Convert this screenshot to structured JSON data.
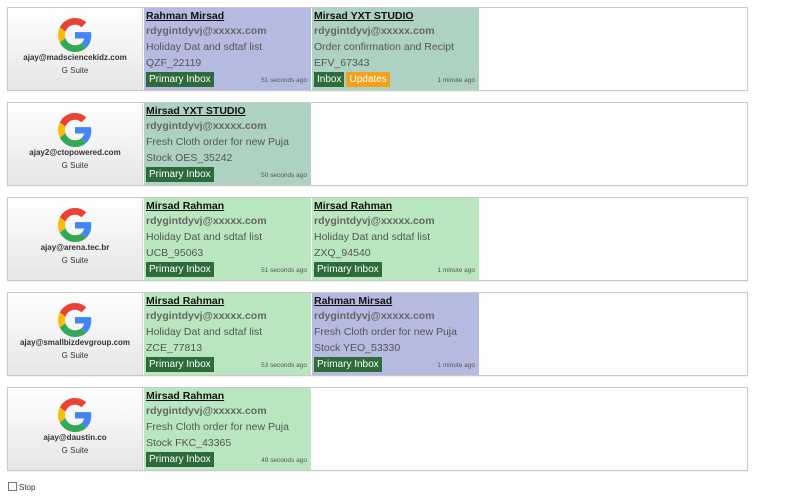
{
  "stop_label": "Stop",
  "colors": {
    "purple": "#b5bbe0",
    "green": "#b9e6be",
    "teal": "#aed2c1",
    "label_green": "#2e6b3b",
    "label_orange": "#f3a01a"
  },
  "rows": [
    {
      "account_icon": "google-g-icon",
      "email": "ajay@madsciencekidz.com",
      "suite": "G Suite",
      "cards": [
        {
          "color": "purple",
          "sender": "Rahman Mirsad",
          "address": "rdygintdyvj@xxxxx.com",
          "subject": "Holiday Dat and sdtaf list",
          "code": "QZF_22119",
          "labels": [
            {
              "text": "Primary Inbox",
              "style": "green"
            }
          ],
          "time": "51 seconds ago"
        },
        {
          "color": "teal",
          "sender": "Mirsad YXT STUDIO",
          "address": "rdygintdyvj@xxxxx.com",
          "subject": "Order confirmation and Recipt",
          "code": "EFV_67343",
          "labels": [
            {
              "text": "Inbox",
              "style": "green"
            },
            {
              "text": "Updates",
              "style": "orange"
            }
          ],
          "time": "1 minute ago"
        }
      ]
    },
    {
      "account_icon": "google-g-icon",
      "email": "ajay2@ctopowered.com",
      "suite": "G Suite",
      "cards": [
        {
          "color": "teal",
          "sender": "Mirsad YXT STUDIO",
          "address": "rdygintdyvj@xxxxx.com",
          "subject": "Fresh Cloth order for new Puja",
          "code": "Stock OES_35242",
          "labels": [
            {
              "text": "Primary Inbox",
              "style": "green"
            }
          ],
          "time": "50 seconds ago"
        }
      ]
    },
    {
      "account_icon": "google-g-icon",
      "email": "ajay@arena.tec.br",
      "suite": "G Suite",
      "cards": [
        {
          "color": "green",
          "sender": "Mirsad Rahman",
          "address": "rdygintdyvj@xxxxx.com",
          "subject": "Holiday Dat and sdtaf list",
          "code": "UCB_95063",
          "labels": [
            {
              "text": "Primary Inbox",
              "style": "green"
            }
          ],
          "time": "51 seconds ago"
        },
        {
          "color": "green",
          "sender": "Mirsad Rahman",
          "address": "rdygintdyvj@xxxxx.com",
          "subject": "Holiday Dat and sdtaf list",
          "code": "ZXQ_94540",
          "labels": [
            {
              "text": "Primary Inbox",
              "style": "green"
            }
          ],
          "time": "1 minute ago"
        }
      ]
    },
    {
      "account_icon": "google-g-icon",
      "email": "ajay@smallbizdevgroup.com",
      "suite": "G Suite",
      "cards": [
        {
          "color": "green",
          "sender": "Mirsad Rahman",
          "address": "rdygintdyvj@xxxxx.com",
          "subject": "Holiday Dat and sdtaf list",
          "code": "ZCE_77813",
          "labels": [
            {
              "text": "Primary Inbox",
              "style": "green"
            }
          ],
          "time": "53 seconds ago"
        },
        {
          "color": "purple",
          "sender": "Rahman Mirsad",
          "address": "rdygintdyvj@xxxxx.com",
          "subject": "Fresh Cloth order for new Puja",
          "code": "Stock YEO_53330",
          "labels": [
            {
              "text": "Primary Inbox",
              "style": "green"
            }
          ],
          "time": "1 minute ago"
        }
      ]
    },
    {
      "account_icon": "google-g-icon",
      "email": "ajay@daustin.co",
      "suite": "G Suite",
      "cards": [
        {
          "color": "green",
          "sender": "Mirsad Rahman",
          "address": "rdygintdyvj@xxxxx.com",
          "subject": "Fresh Cloth order for new Puja",
          "code": "Stock FKC_43365",
          "labels": [
            {
              "text": "Primary Inbox",
              "style": "green"
            }
          ],
          "time": "49 seconds ago"
        }
      ]
    }
  ]
}
